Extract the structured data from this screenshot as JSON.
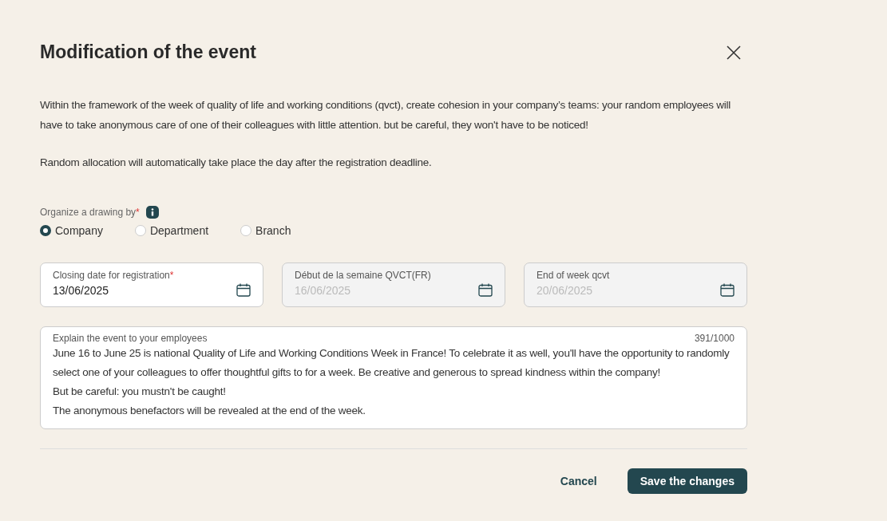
{
  "dialog": {
    "title": "Modification of the event"
  },
  "description": [
    "Within the framework of the week of quality of life and working conditions (qvct), create cohesion in your company’s teams: your random employees will have to take anonymous care of one of their colleagues with little attention. but be careful, they won't have to be noticed!",
    "Random allocation will automatically take place the day after the registration deadline."
  ],
  "drawing": {
    "label": "Organize a drawing by",
    "required_mark": "*",
    "options": [
      {
        "label": "Company",
        "selected": true
      },
      {
        "label": "Department",
        "selected": false
      },
      {
        "label": "Branch",
        "selected": false
      }
    ]
  },
  "date_fields": [
    {
      "label": "Closing date for registration",
      "required_mark": "*",
      "value": "13/06/2025",
      "disabled": false
    },
    {
      "label": "Début de la semaine QVCT(FR)",
      "value": "16/06/2025",
      "disabled": true
    },
    {
      "label": "End of week qcvt",
      "value": "20/06/2025",
      "disabled": true
    }
  ],
  "explanation": {
    "label": "Explain the event to your employees",
    "counter": "391/1000",
    "value": "June 16 to June 25 is national Quality of Life and Working Conditions Week in France! To celebrate it as well, you'll have the opportunity to randomly select one of your colleagues to offer thoughtful gifts to for a week. Be creative and generous to spread kindness within the company!\nBut be careful: you mustn't be caught!\nThe anonymous benefactors will be revealed at the end of the week."
  },
  "buttons": {
    "cancel": "Cancel",
    "save": "Save the changes"
  }
}
